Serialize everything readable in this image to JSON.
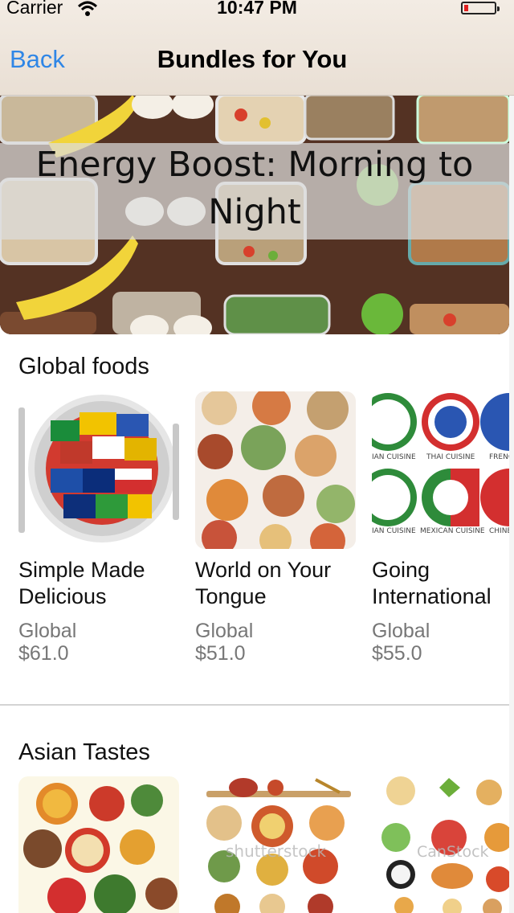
{
  "status_bar": {
    "carrier": "Carrier",
    "time": "10:47 PM"
  },
  "nav": {
    "back_label": "Back",
    "title": "Bundles for You"
  },
  "hero": {
    "title": "Energy Boost: Morning to Night"
  },
  "sections": [
    {
      "title": "Global foods",
      "cards": [
        {
          "name": "Simple Made Delicious",
          "category": "Global",
          "price": "$61.0"
        },
        {
          "name": "World on Your Tongue",
          "category": "Global",
          "price": "$51.0"
        },
        {
          "name": "Going International",
          "category": "Global",
          "price": "$55.0"
        }
      ]
    },
    {
      "title": "Asian Tastes"
    }
  ],
  "image_labels": {
    "cuisine_top": [
      "IAN CUISINE",
      "THAI CUISINE",
      "FRENC"
    ],
    "cuisine_bottom": [
      "IAN CUISINE",
      "MEXICAN CUISINE",
      "CHINE"
    ],
    "watermark_shutterstock": "shutterstock",
    "watermark_canstock": "CanStock"
  },
  "colors": {
    "accent": "#2f86e6",
    "navbar_bg": "#ece3d9",
    "secondary_text": "#777777"
  }
}
